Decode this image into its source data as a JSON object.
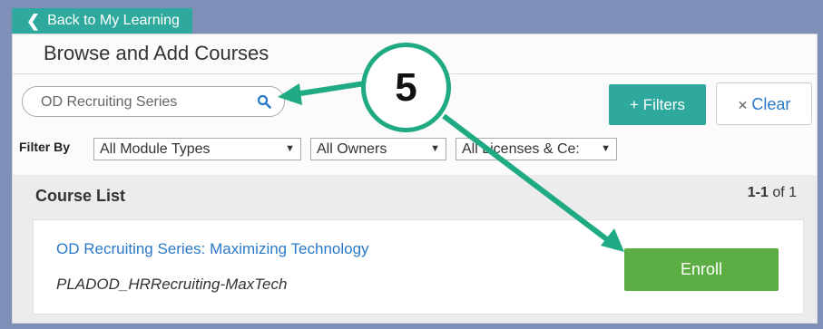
{
  "nav": {
    "back_label": "Back to My Learning"
  },
  "page": {
    "title": "Browse and Add Courses"
  },
  "search": {
    "value": "OD Recruiting Series"
  },
  "buttons": {
    "filters": "+ Filters",
    "clear": "Clear"
  },
  "filter_by": {
    "label": "Filter By",
    "module_type": "All Module Types",
    "owner": "All Owners",
    "licenses": "All Licenses & Ce:"
  },
  "course_list": {
    "title": "Course List",
    "count_range": "1-1",
    "count_of": "of 1",
    "courses": [
      {
        "name": "OD Recruiting Series: Maximizing Technology",
        "code": "PLADOD_HRRecruiting-MaxTech",
        "action": "Enroll"
      }
    ]
  },
  "annotation": {
    "step_number": "5",
    "color": "#1faa83"
  }
}
